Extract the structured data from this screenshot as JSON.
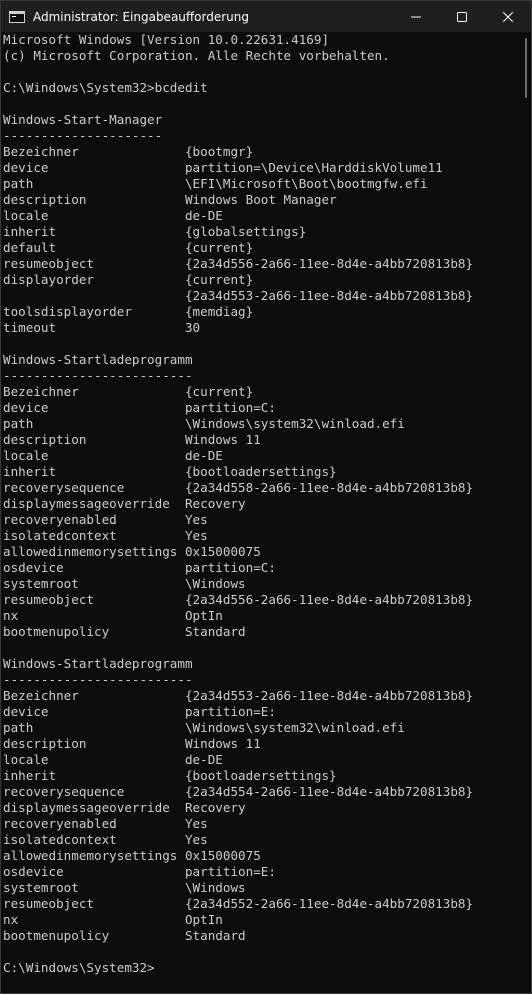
{
  "window": {
    "title": "Administrator: Eingabeaufforderung",
    "icon": "terminal-icon",
    "controls": [
      "minimize-icon",
      "maximize-icon",
      "close-icon"
    ]
  },
  "colors": {
    "background": "#0c0c0c",
    "text": "#cccccc",
    "titlebar": "#1f1f1f"
  },
  "console": {
    "lines": [
      "Microsoft Windows [Version 10.0.22631.4169]",
      "(c) Microsoft Corporation. Alle Rechte vorbehalten.",
      "",
      "C:\\Windows\\System32>bcdedit",
      "",
      "Windows-Start-Manager",
      "---------------------",
      "Bezeichner              {bootmgr}",
      "device                  partition=\\Device\\HarddiskVolume11",
      "path                    \\EFI\\Microsoft\\Boot\\bootmgfw.efi",
      "description             Windows Boot Manager",
      "locale                  de-DE",
      "inherit                 {globalsettings}",
      "default                 {current}",
      "resumeobject            {2a34d556-2a66-11ee-8d4e-a4bb720813b8}",
      "displayorder            {current}",
      "                        {2a34d553-2a66-11ee-8d4e-a4bb720813b8}",
      "toolsdisplayorder       {memdiag}",
      "timeout                 30",
      "",
      "Windows-Startladeprogramm",
      "-------------------------",
      "Bezeichner              {current}",
      "device                  partition=C:",
      "path                    \\Windows\\system32\\winload.efi",
      "description             Windows 11",
      "locale                  de-DE",
      "inherit                 {bootloadersettings}",
      "recoverysequence        {2a34d558-2a66-11ee-8d4e-a4bb720813b8}",
      "displaymessageoverride  Recovery",
      "recoveryenabled         Yes",
      "isolatedcontext         Yes",
      "allowedinmemorysettings 0x15000075",
      "osdevice                partition=C:",
      "systemroot              \\Windows",
      "resumeobject            {2a34d556-2a66-11ee-8d4e-a4bb720813b8}",
      "nx                      OptIn",
      "bootmenupolicy          Standard",
      "",
      "Windows-Startladeprogramm",
      "-------------------------",
      "Bezeichner              {2a34d553-2a66-11ee-8d4e-a4bb720813b8}",
      "device                  partition=E:",
      "path                    \\Windows\\system32\\winload.efi",
      "description             Windows 11",
      "locale                  de-DE",
      "inherit                 {bootloadersettings}",
      "recoverysequence        {2a34d554-2a66-11ee-8d4e-a4bb720813b8}",
      "displaymessageoverride  Recovery",
      "recoveryenabled         Yes",
      "isolatedcontext         Yes",
      "allowedinmemorysettings 0x15000075",
      "osdevice                partition=E:",
      "systemroot              \\Windows",
      "resumeobject            {2a34d552-2a66-11ee-8d4e-a4bb720813b8}",
      "nx                      OptIn",
      "bootmenupolicy          Standard",
      "",
      "C:\\Windows\\System32>"
    ]
  }
}
